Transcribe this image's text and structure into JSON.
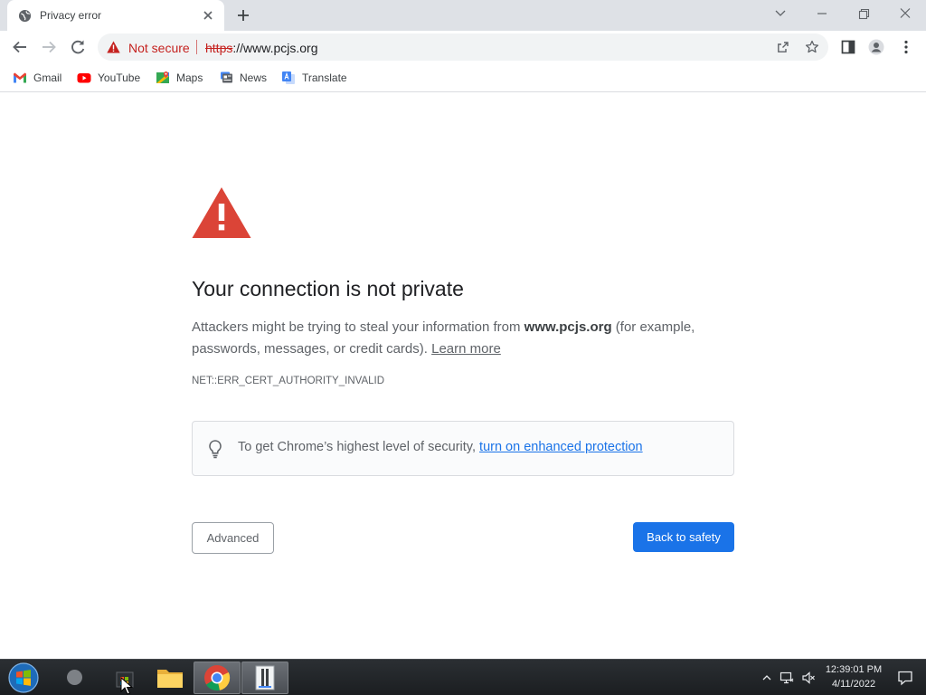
{
  "tab": {
    "title": "Privacy error",
    "favicon": "globe-icon"
  },
  "toolbar": {
    "security_label": "Not secure",
    "url_scheme": "https",
    "url_rest": "://www.pcjs.org"
  },
  "bookmarks": [
    {
      "label": "Gmail",
      "icon": "gmail-icon"
    },
    {
      "label": "YouTube",
      "icon": "youtube-icon"
    },
    {
      "label": "Maps",
      "icon": "maps-icon"
    },
    {
      "label": "News",
      "icon": "news-icon"
    },
    {
      "label": "Translate",
      "icon": "translate-icon"
    }
  ],
  "interstitial": {
    "heading": "Your connection is not private",
    "explanation_pre": "Attackers might be trying to steal your information from ",
    "explanation_host": "www.pcjs.org",
    "explanation_post": " (for example, passwords, messages, or credit cards).",
    "learn_more": "Learn more",
    "error_code": "NET::ERR_CERT_AUTHORITY_INVALID",
    "enhanced_text": "To get Chrome’s highest level of security,",
    "enhanced_link": "turn on enhanced protection",
    "advanced_button": "Advanced",
    "back_button": "Back to safety"
  },
  "taskbar": {
    "time": "12:39:01 PM",
    "date": "4/11/2022"
  },
  "colors": {
    "accent": "#1a73e8",
    "danger": "#c5221f",
    "warning_red": "#db4437"
  }
}
